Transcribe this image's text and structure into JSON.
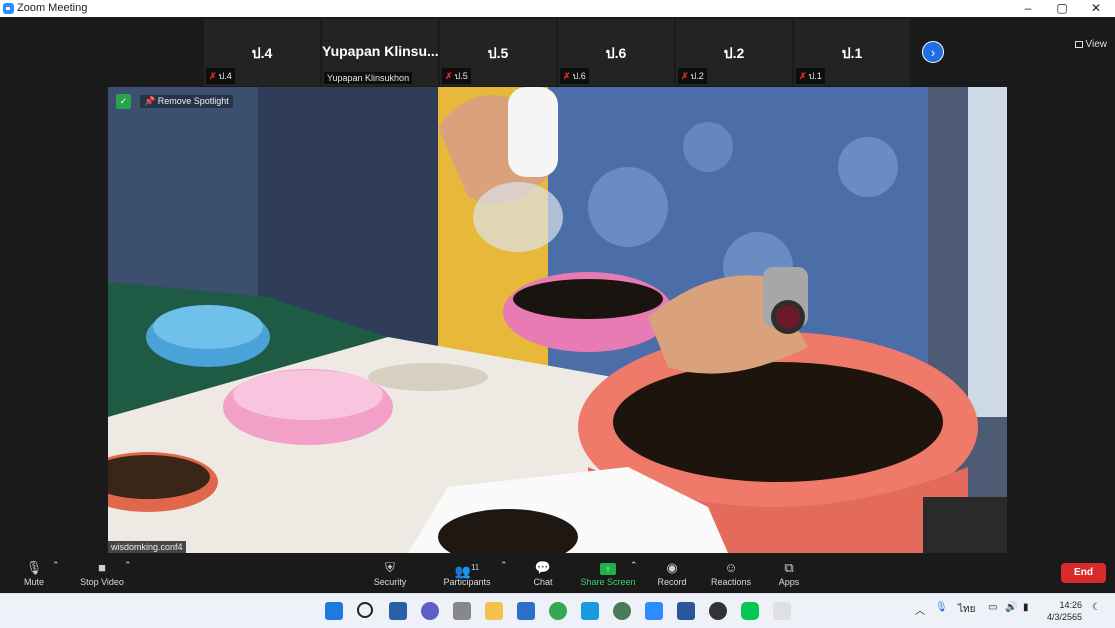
{
  "window": {
    "title": "Zoom Meeting",
    "controls": [
      "–",
      "▢",
      "✕"
    ]
  },
  "view_button": {
    "label": "View"
  },
  "participants_strip": [
    {
      "name": "ป.4",
      "caption": "ป.4",
      "muted": true
    },
    {
      "name": "Yupapan  Klinsu...",
      "caption": "Yupapan Klinsukhon",
      "muted": false
    },
    {
      "name": "ป.5",
      "caption": "ป.5",
      "muted": true
    },
    {
      "name": "ป.6",
      "caption": "ป.6",
      "muted": true
    },
    {
      "name": "ป.2",
      "caption": "ป.2",
      "muted": true
    },
    {
      "name": "ป.1",
      "caption": "ป.1",
      "muted": true
    }
  ],
  "spotlight": {
    "remove_label": "Remove Spotlight",
    "video_label": "wisdomking.conf4"
  },
  "toolbar": {
    "mute": "Mute",
    "stop_video": "Stop Video",
    "security": "Security",
    "participants": "Participants",
    "participant_count": "11",
    "chat": "Chat",
    "share_screen": "Share Screen",
    "record": "Record",
    "reactions": "Reactions",
    "apps": "Apps",
    "end": "End"
  },
  "taskbar": {
    "language": "ไทย",
    "time": "14:26",
    "date": "4/3/2565"
  },
  "colors": {
    "accent": "#2d8cff",
    "share_green": "#22b14c",
    "end_red": "#d92b2b",
    "muted_red": "#e02828"
  }
}
